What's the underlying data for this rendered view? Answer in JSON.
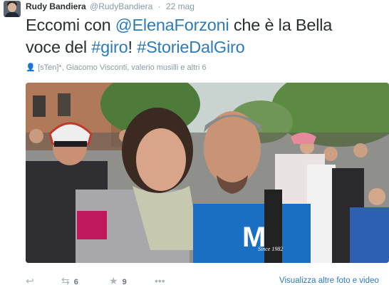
{
  "tweet": {
    "author_name": "Rudy Bandiera",
    "author_handle": "@RudyBandiera",
    "separator": "·",
    "timestamp": "22 mag",
    "text": {
      "part1": "Eccomi con ",
      "mention": "@ElenaForzoni",
      "part2": " che è la Bella voce del ",
      "hashtag1": "#giro",
      "part3": "! ",
      "hashtag2": "#StorieDalGiro"
    },
    "retweeters": "[sTen]*, Giacomo Visconti, valerio musilli e altri 6",
    "photo": {
      "description_icon": "photo-image",
      "shirt_letter": "M",
      "shirt_small_text": "Since 1982"
    },
    "actions": {
      "reply_icon": "reply-icon",
      "retweet_icon": "retweet-icon",
      "retweet_count": "6",
      "favorite_icon": "star-icon",
      "favorite_count": "9",
      "more_icon": "more-icon"
    },
    "view_more_label": "Visualizza altre foto e video"
  },
  "colors": {
    "link": "#2b7bb9",
    "muted": "#8899a6",
    "text": "#292f33"
  }
}
